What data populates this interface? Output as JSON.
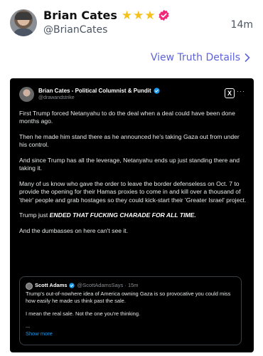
{
  "header": {
    "name": "Brian Cates",
    "handle": "@BrianCates",
    "time": "14m",
    "star_count": 3,
    "star_icon": "star-icon",
    "verified_icon": "verified-badge-icon",
    "accent_color": "#f0287a"
  },
  "details_link": {
    "label": "View Truth Details",
    "chevron": "›",
    "color": "#5e64d8"
  },
  "tweet": {
    "author_name": "Brian Cates - Political Columnist & Pundit",
    "author_handle": "@drawandstrike",
    "x_logo": "X",
    "more": "···",
    "paragraphs": [
      "First Trump forced Netanyahu to do the deal when a deal could have been done months ago.",
      "Then he made him stand there as he announced he's taking Gaza out from under his control.",
      "And since Trump has all the leverage, Netanyahu ends up just standing there and taking it.",
      "Many of us know who gave the order to leave the border defenseless on Oct. 7 to provide the opening for their Hamas proxies to come in and kill over a thousand of 'their' people and grab hostages so they could kick-start their 'Greater Israel' project."
    ],
    "emphasis_prefix": "Trump just ",
    "emphasis_text": "ENDED THAT FUCKING CHARADE FOR ALL TIME.",
    "closing": "And the dumbasses on here can't see it.",
    "quote": {
      "name": "Scott Adams",
      "meta": "@ScottAdamsSays · 15m",
      "paragraphs": [
        "Trump's out-of-nowhere idea of America owning Gaza is so provocative you could miss how easily he made us think past the sale.",
        "I mean the real sale. Not the one you're thinking."
      ],
      "ellipsis": "...",
      "show_more": "Show more"
    }
  }
}
